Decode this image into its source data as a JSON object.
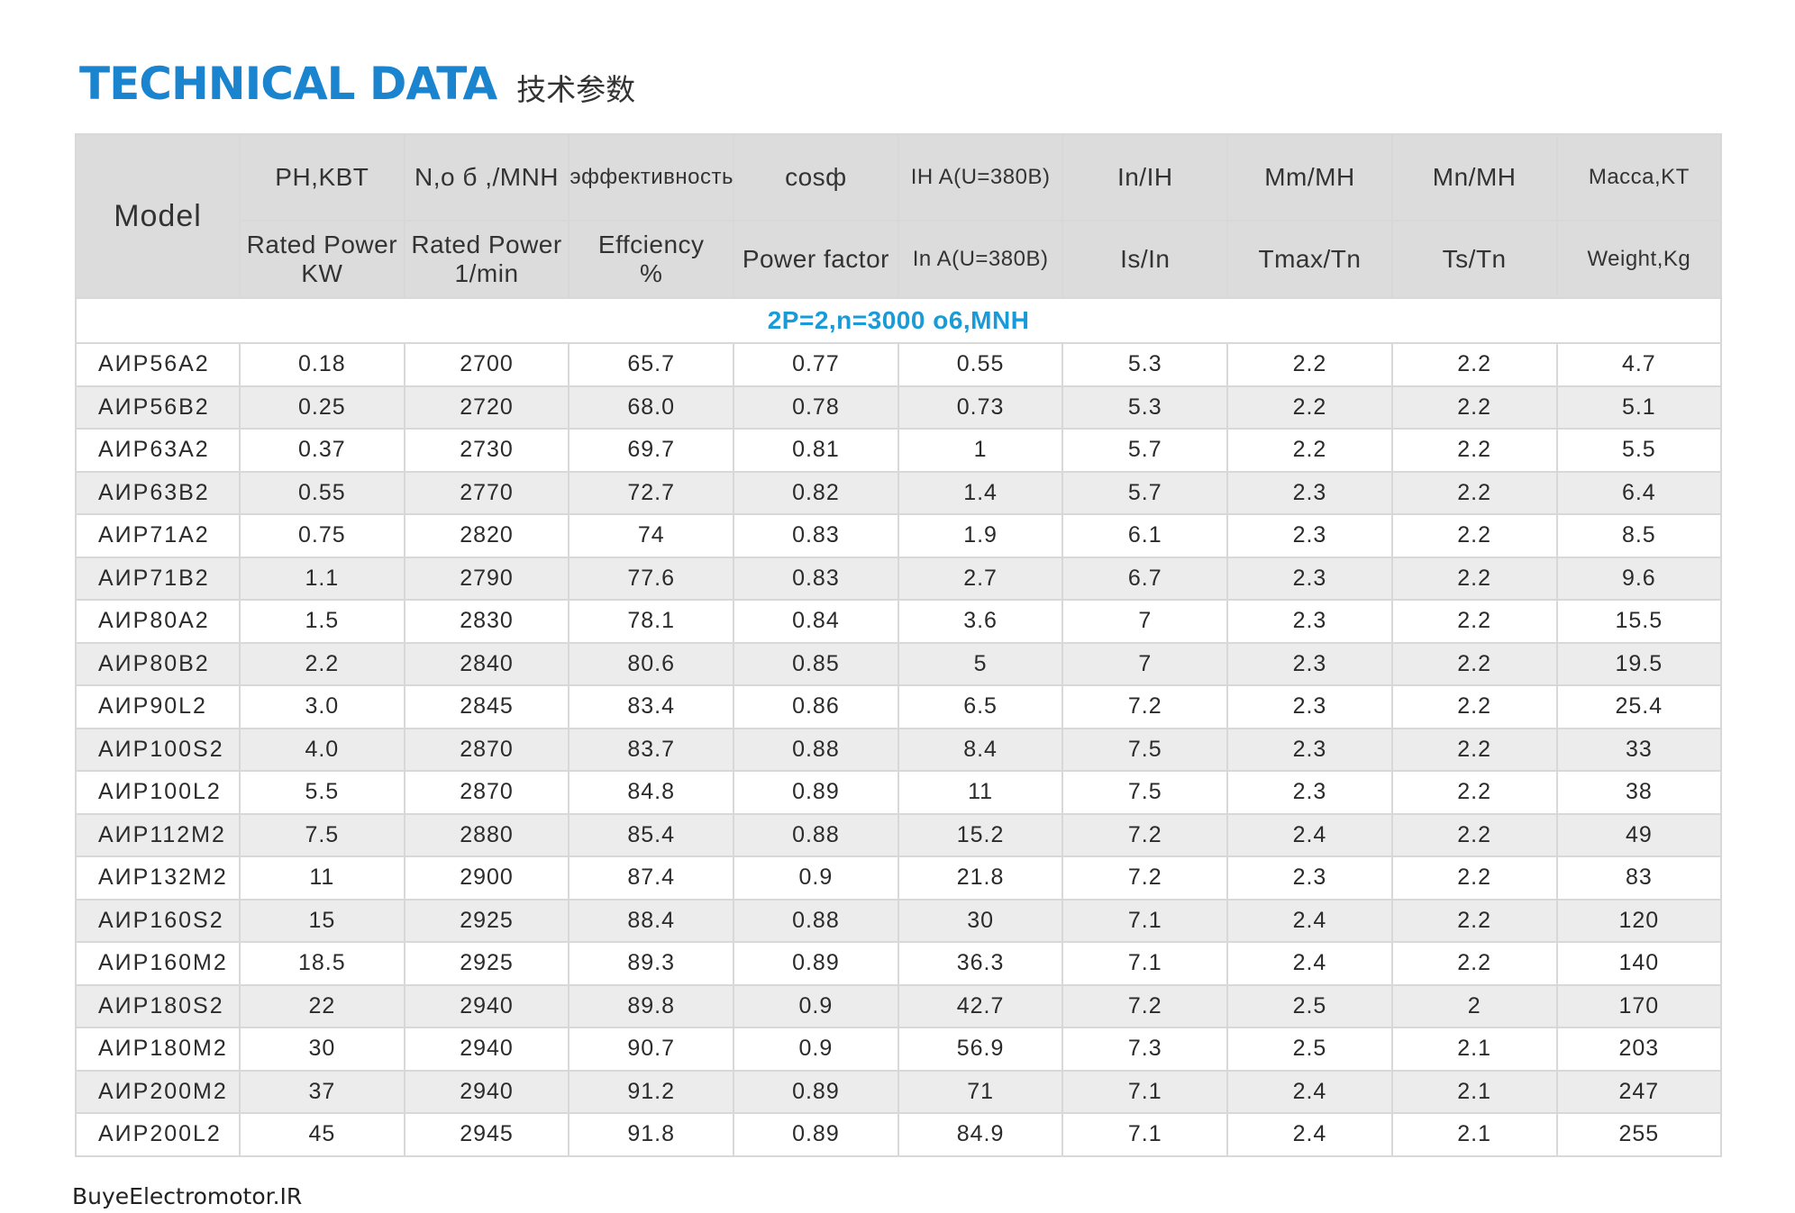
{
  "title": {
    "main": "TECHNICAL DATA",
    "sub": "技术参数"
  },
  "headers": {
    "model": "Model",
    "row1": [
      "PH,KBT",
      "N,o б ,/MNH",
      "эффективность",
      "cosф",
      "IH A(U=380B)",
      "In/IH",
      "Mm/MH",
      "Mn/MH",
      "Macca,KT"
    ],
    "row2": [
      [
        "Rated Power",
        "KW"
      ],
      [
        "Rated Power",
        "1/min"
      ],
      [
        "Effciency",
        "%"
      ],
      [
        "Power factor"
      ],
      [
        "In A(U=380B)"
      ],
      [
        "Is/In"
      ],
      [
        "Tmax/Tn"
      ],
      [
        "Ts/Tn"
      ],
      [
        "Weight,Kg"
      ]
    ]
  },
  "section_label": "2P=2,n=3000 o6,MNH",
  "rows": [
    [
      "AИP56A2",
      "0.18",
      "2700",
      "65.7",
      "0.77",
      "0.55",
      "5.3",
      "2.2",
      "2.2",
      "4.7"
    ],
    [
      "AИP56B2",
      "0.25",
      "2720",
      "68.0",
      "0.78",
      "0.73",
      "5.3",
      "2.2",
      "2.2",
      "5.1"
    ],
    [
      "AИP63A2",
      "0.37",
      "2730",
      "69.7",
      "0.81",
      "1",
      "5.7",
      "2.2",
      "2.2",
      "5.5"
    ],
    [
      "AИP63B2",
      "0.55",
      "2770",
      "72.7",
      "0.82",
      "1.4",
      "5.7",
      "2.3",
      "2.2",
      "6.4"
    ],
    [
      "AИP71A2",
      "0.75",
      "2820",
      "74",
      "0.83",
      "1.9",
      "6.1",
      "2.3",
      "2.2",
      "8.5"
    ],
    [
      "AИP71B2",
      "1.1",
      "2790",
      "77.6",
      "0.83",
      "2.7",
      "6.7",
      "2.3",
      "2.2",
      "9.6"
    ],
    [
      "AИP80A2",
      "1.5",
      "2830",
      "78.1",
      "0.84",
      "3.6",
      "7",
      "2.3",
      "2.2",
      "15.5"
    ],
    [
      "AИP80B2",
      "2.2",
      "2840",
      "80.6",
      "0.85",
      "5",
      "7",
      "2.3",
      "2.2",
      "19.5"
    ],
    [
      "AИP90L2",
      "3.0",
      "2845",
      "83.4",
      "0.86",
      "6.5",
      "7.2",
      "2.3",
      "2.2",
      "25.4"
    ],
    [
      "AИP100S2",
      "4.0",
      "2870",
      "83.7",
      "0.88",
      "8.4",
      "7.5",
      "2.3",
      "2.2",
      "33"
    ],
    [
      "AИP100L2",
      "5.5",
      "2870",
      "84.8",
      "0.89",
      "11",
      "7.5",
      "2.3",
      "2.2",
      "38"
    ],
    [
      "AИP112M2",
      "7.5",
      "2880",
      "85.4",
      "0.88",
      "15.2",
      "7.2",
      "2.4",
      "2.2",
      "49"
    ],
    [
      "AИP132M2",
      "11",
      "2900",
      "87.4",
      "0.9",
      "21.8",
      "7.2",
      "2.3",
      "2.2",
      "83"
    ],
    [
      "AИP160S2",
      "15",
      "2925",
      "88.4",
      "0.88",
      "30",
      "7.1",
      "2.4",
      "2.2",
      "120"
    ],
    [
      "AИP160M2",
      "18.5",
      "2925",
      "89.3",
      "0.89",
      "36.3",
      "7.1",
      "2.4",
      "2.2",
      "140"
    ],
    [
      "AИP180S2",
      "22",
      "2940",
      "89.8",
      "0.9",
      "42.7",
      "7.2",
      "2.5",
      "2",
      "170"
    ],
    [
      "AИP180M2",
      "30",
      "2940",
      "90.7",
      "0.9",
      "56.9",
      "7.3",
      "2.5",
      "2.1",
      "203"
    ],
    [
      "AИP200M2",
      "37",
      "2940",
      "91.2",
      "0.89",
      "71",
      "7.1",
      "2.4",
      "2.1",
      "247"
    ],
    [
      "AИP200L2",
      "45",
      "2945",
      "91.8",
      "0.89",
      "84.9",
      "7.1",
      "2.4",
      "2.1",
      "255"
    ]
  ],
  "footer": "BuyeElectromotor.IR",
  "colors": {
    "title": "#1a84cf",
    "section": "#1a9bd7",
    "header_bg": "#dcdcdc",
    "row_alt": "#ececec"
  }
}
